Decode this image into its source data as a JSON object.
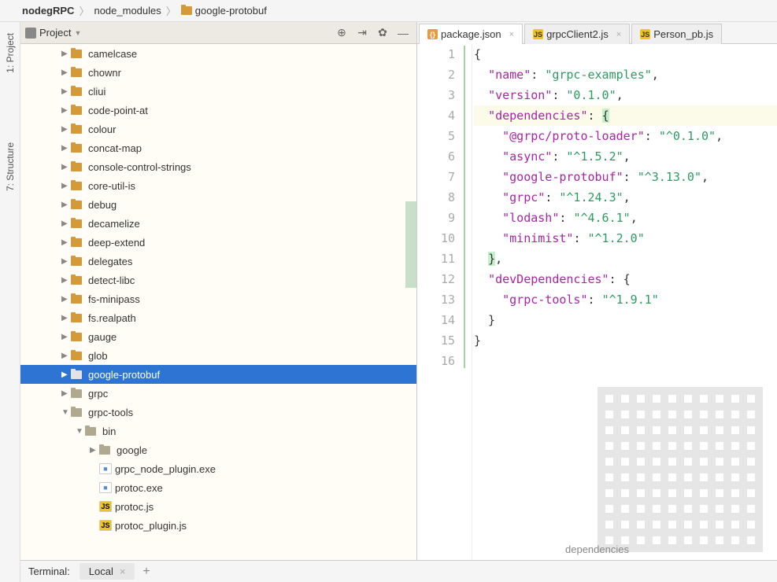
{
  "breadcrumb": {
    "items": [
      {
        "label": "nodegRPC",
        "bold": true,
        "folder": false
      },
      {
        "label": "node_modules",
        "bold": false,
        "folder": false
      },
      {
        "label": "google-protobuf",
        "bold": false,
        "folder": true
      }
    ]
  },
  "sidebar_tabs": {
    "project": {
      "label": "1: Project"
    },
    "structure": {
      "label": "7: Structure"
    }
  },
  "project_panel": {
    "title": "Project",
    "tree": [
      {
        "depth": 1,
        "kind": "folder",
        "label": "camelcase",
        "collapsed": true
      },
      {
        "depth": 1,
        "kind": "folder",
        "label": "chownr",
        "collapsed": true
      },
      {
        "depth": 1,
        "kind": "folder",
        "label": "cliui",
        "collapsed": true
      },
      {
        "depth": 1,
        "kind": "folder",
        "label": "code-point-at",
        "collapsed": true
      },
      {
        "depth": 1,
        "kind": "folder",
        "label": "colour",
        "collapsed": true
      },
      {
        "depth": 1,
        "kind": "folder",
        "label": "concat-map",
        "collapsed": true
      },
      {
        "depth": 1,
        "kind": "folder",
        "label": "console-control-strings",
        "collapsed": true
      },
      {
        "depth": 1,
        "kind": "folder",
        "label": "core-util-is",
        "collapsed": true
      },
      {
        "depth": 1,
        "kind": "folder",
        "label": "debug",
        "collapsed": true
      },
      {
        "depth": 1,
        "kind": "folder",
        "label": "decamelize",
        "collapsed": true
      },
      {
        "depth": 1,
        "kind": "folder",
        "label": "deep-extend",
        "collapsed": true
      },
      {
        "depth": 1,
        "kind": "folder",
        "label": "delegates",
        "collapsed": true
      },
      {
        "depth": 1,
        "kind": "folder",
        "label": "detect-libc",
        "collapsed": true
      },
      {
        "depth": 1,
        "kind": "folder",
        "label": "fs-minipass",
        "collapsed": true
      },
      {
        "depth": 1,
        "kind": "folder",
        "label": "fs.realpath",
        "collapsed": true
      },
      {
        "depth": 1,
        "kind": "folder",
        "label": "gauge",
        "collapsed": true
      },
      {
        "depth": 1,
        "kind": "folder",
        "label": "glob",
        "collapsed": true
      },
      {
        "depth": 1,
        "kind": "folder-grey",
        "label": "google-protobuf",
        "collapsed": true,
        "selected": true
      },
      {
        "depth": 1,
        "kind": "folder-grey",
        "label": "grpc",
        "collapsed": true
      },
      {
        "depth": 1,
        "kind": "folder-grey",
        "label": "grpc-tools",
        "collapsed": false
      },
      {
        "depth": 2,
        "kind": "folder-grey",
        "label": "bin",
        "collapsed": false
      },
      {
        "depth": 3,
        "kind": "folder-grey",
        "label": "google",
        "collapsed": true
      },
      {
        "depth": 3,
        "kind": "file-unknown",
        "label": "grpc_node_plugin.exe",
        "collapsed": null
      },
      {
        "depth": 3,
        "kind": "file-unknown",
        "label": "protoc.exe",
        "collapsed": null
      },
      {
        "depth": 3,
        "kind": "file-js",
        "label": "protoc.js",
        "collapsed": null
      },
      {
        "depth": 3,
        "kind": "file-js",
        "label": "protoc_plugin.js",
        "collapsed": null
      }
    ]
  },
  "tabs": [
    {
      "label": "package.json",
      "icon": "json",
      "active": true,
      "closable": true
    },
    {
      "label": "grpcClient2.js",
      "icon": "js",
      "active": false,
      "closable": true
    },
    {
      "label": "Person_pb.js",
      "icon": "js",
      "active": false,
      "closable": false
    }
  ],
  "code": {
    "lines": [
      "{",
      "  \"name\": \"grpc-examples\",",
      "  \"version\": \"0.1.0\",",
      "  \"dependencies\": {",
      "    \"@grpc/proto-loader\": \"^0.1.0\",",
      "    \"async\": \"^1.5.2\",",
      "    \"google-protobuf\": \"^3.13.0\",",
      "    \"grpc\": \"^1.24.3\",",
      "    \"lodash\": \"^4.6.1\",",
      "    \"minimist\": \"^1.2.0\"",
      "  },",
      "  \"devDependencies\": {",
      "    \"grpc-tools\": \"^1.9.1\"",
      "  }",
      "}",
      ""
    ],
    "highlighted_line": 4
  },
  "editor_breadcrumb": "dependencies",
  "bottom": {
    "terminal_label": "Terminal:",
    "tab_label": "Local"
  }
}
